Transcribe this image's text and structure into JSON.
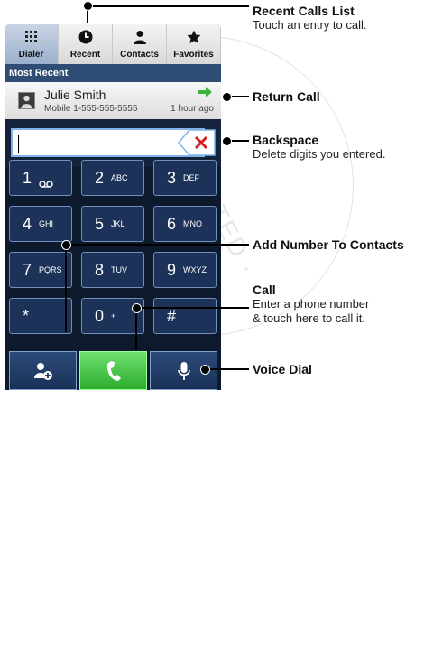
{
  "watermark": "RESTRICTED · MOTOROLA CONFIDENTIAL",
  "tabs": [
    {
      "label": "Dialer",
      "icon": "grid-icon",
      "selected": true
    },
    {
      "label": "Recent",
      "icon": "clock-icon",
      "selected": false
    },
    {
      "label": "Contacts",
      "icon": "person-icon",
      "selected": false
    },
    {
      "label": "Favorites",
      "icon": "star-icon",
      "selected": false
    }
  ],
  "recent": {
    "header": "Most Recent",
    "name": "Julie Smith",
    "detail": "Mobile 1-555-555-5555",
    "time": "1 hour ago"
  },
  "digit_field": {
    "value": "",
    "backspace_icon": "backspace-x-icon"
  },
  "keys": [
    {
      "digit": "1",
      "letters": ""
    },
    {
      "digit": "2",
      "letters": "ABC"
    },
    {
      "digit": "3",
      "letters": "DEF"
    },
    {
      "digit": "4",
      "letters": "GHI"
    },
    {
      "digit": "5",
      "letters": "JKL"
    },
    {
      "digit": "6",
      "letters": "MNO"
    },
    {
      "digit": "7",
      "letters": "PQRS"
    },
    {
      "digit": "8",
      "letters": "TUV"
    },
    {
      "digit": "9",
      "letters": "WXYZ"
    },
    {
      "digit": "*",
      "letters": ""
    },
    {
      "digit": "0",
      "letters": "+"
    },
    {
      "digit": "#",
      "letters": ""
    }
  ],
  "actions": {
    "add_contact_icon": "add-contact-icon",
    "call_icon": "phone-handset-icon",
    "voice_icon": "microphone-icon"
  },
  "callouts": {
    "recent_calls": {
      "title": "Recent Calls List",
      "desc": "Touch an entry to call."
    },
    "return_call": {
      "title": "Return Call"
    },
    "backspace": {
      "title": "Backspace",
      "desc": "Delete digits you entered."
    },
    "add_number": {
      "title": "Add Number To Contacts"
    },
    "call": {
      "title": "Call",
      "desc1": "Enter a phone number",
      "desc2": "& touch here to call it."
    },
    "voice_dial": {
      "title": "Voice Dial"
    }
  },
  "colors": {
    "accent": "#2f4c74",
    "call_green": "#3cc03c",
    "return_arrow": "#3cb43c",
    "backspace_x": "#d42020"
  }
}
